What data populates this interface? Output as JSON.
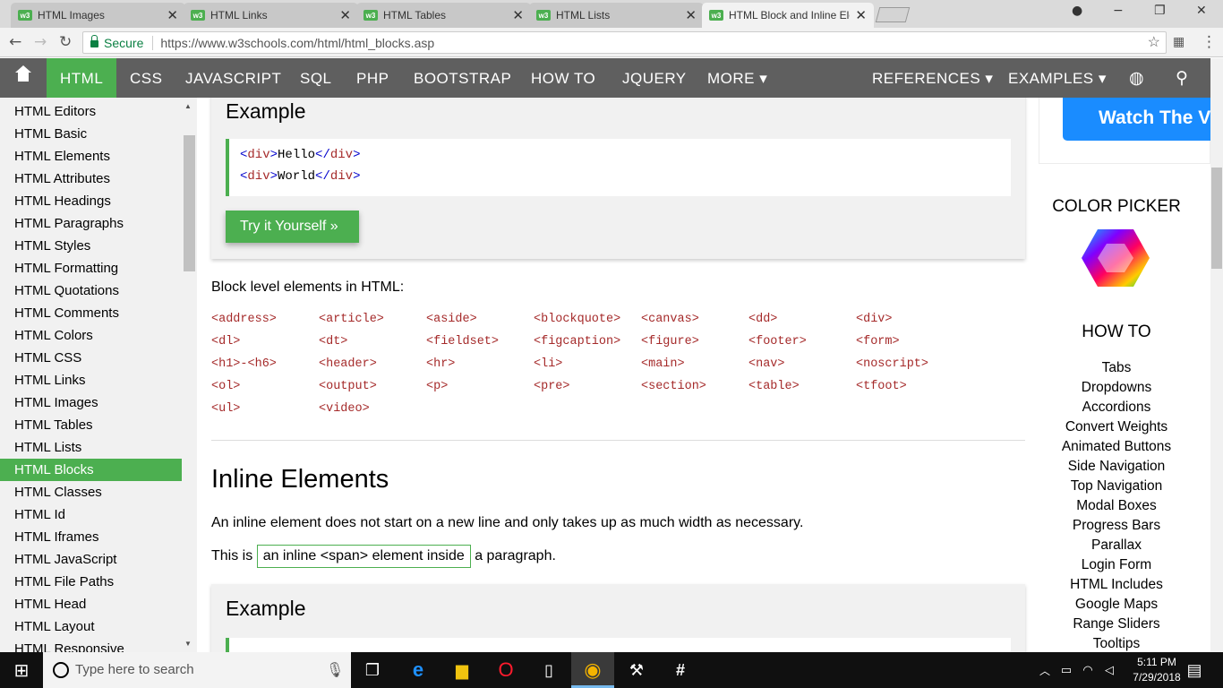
{
  "browser": {
    "tabs": [
      {
        "title": "HTML Images",
        "close": "✕"
      },
      {
        "title": "HTML Links",
        "close": "✕"
      },
      {
        "title": "HTML Tables",
        "close": "✕"
      },
      {
        "title": "HTML Lists",
        "close": "✕"
      },
      {
        "title": "HTML Block and Inline Ele",
        "close": "✕"
      }
    ],
    "favicon": "w3",
    "secure_label": "Secure",
    "url": "https://www.w3schools.com/html/html_blocks.asp"
  },
  "topnav": {
    "items": [
      "HTML",
      "CSS",
      "JAVASCRIPT",
      "SQL",
      "PHP",
      "BOOTSTRAP",
      "HOW TO",
      "JQUERY",
      "MORE ▾",
      "REFERENCES ▾",
      "EXAMPLES ▾"
    ]
  },
  "sidebar": {
    "items": [
      "HTML Editors",
      "HTML Basic",
      "HTML Elements",
      "HTML Attributes",
      "HTML Headings",
      "HTML Paragraphs",
      "HTML Styles",
      "HTML Formatting",
      "HTML Quotations",
      "HTML Comments",
      "HTML Colors",
      "HTML CSS",
      "HTML Links",
      "HTML Images",
      "HTML Tables",
      "HTML Lists",
      "HTML Blocks",
      "HTML Classes",
      "HTML Id",
      "HTML Iframes",
      "HTML JavaScript",
      "HTML File Paths",
      "HTML Head",
      "HTML Layout",
      "HTML Responsive"
    ],
    "active_index": 16
  },
  "main": {
    "example1": {
      "heading": "Example",
      "code_lines": [
        {
          "open": "<",
          "tag": "div",
          "close": ">",
          "text": "Hello",
          "end_open": "</",
          "end_tag": "div",
          "end_close": ">"
        },
        {
          "open": "<",
          "tag": "div",
          "close": ">",
          "text": "World",
          "end_open": "</",
          "end_tag": "div",
          "end_close": ">"
        }
      ],
      "try_button": "Try it Yourself »"
    },
    "block_intro": "Block level elements in HTML:",
    "block_elements": [
      "<address>",
      "<article>",
      "<aside>",
      "<blockquote>",
      "<canvas>",
      "<dd>",
      "<div>",
      "<dl>",
      "<dt>",
      "<fieldset>",
      "<figcaption>",
      "<figure>",
      "<footer>",
      "<form>",
      "<h1>-<h6>",
      "<header>",
      "<hr>",
      "<li>",
      "<main>",
      "<nav>",
      "<noscript>",
      "<ol>",
      "<output>",
      "<p>",
      "<pre>",
      "<section>",
      "<table>",
      "<tfoot>",
      "<ul>",
      "<video>"
    ],
    "inline_heading": "Inline Elements",
    "inline_desc": "An inline element does not start on a new line and only takes up as much width as necessary.",
    "inline_example_before": "This is",
    "inline_example_span": "an inline <span> element inside",
    "inline_example_after": "a paragraph.",
    "example2": {
      "heading": "Example"
    }
  },
  "right": {
    "ad_text": "Watch The V",
    "color_picker_heading": "COLOR PICKER",
    "howto_heading": "HOW TO",
    "howto_links": [
      "Tabs",
      "Dropdowns",
      "Accordions",
      "Convert Weights",
      "Animated Buttons",
      "Side Navigation",
      "Top Navigation",
      "Modal Boxes",
      "Progress Bars",
      "Parallax",
      "Login Form",
      "HTML Includes",
      "Google Maps",
      "Range Sliders",
      "Tooltips"
    ]
  },
  "taskbar": {
    "search_placeholder": "Type here to search",
    "time": "5:11 PM",
    "date": "7/29/2018"
  },
  "colors": {
    "accent": "#4caf50",
    "nav_bg": "#5f5f5f",
    "sidebar_bg": "#f1f1f1",
    "ad_blue": "#1a8cff"
  }
}
